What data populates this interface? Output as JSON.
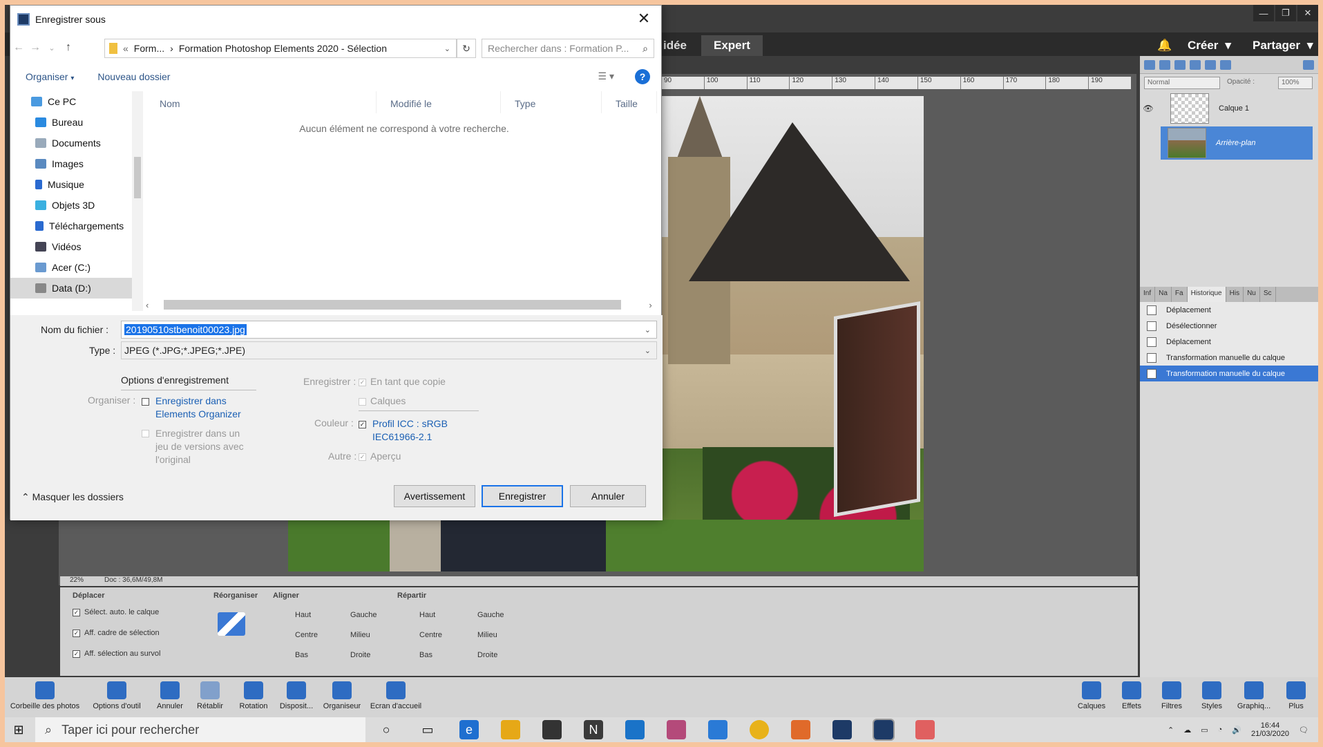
{
  "app": {
    "window_controls": [
      "—",
      "❐",
      "✕"
    ],
    "modes": {
      "guided": "idée",
      "expert": "Expert"
    },
    "create": "Créer",
    "share": "Partager",
    "blend_mode": "Normal",
    "opacity_label": "Opacité :",
    "opacity_value": "100%",
    "layers": [
      {
        "name": "Calque 1"
      },
      {
        "name": "Arrière-plan"
      }
    ],
    "history_tabs": [
      "Inf",
      "Na",
      "Fa",
      "Historique",
      "His",
      "Nu",
      "Sc"
    ],
    "history_items": [
      "Déplacement",
      "Désélectionner",
      "Déplacement",
      "Transformation manuelle du calque",
      "Transformation manuelle du calque"
    ],
    "ruler_ticks": [
      "90",
      "100",
      "110",
      "120",
      "130",
      "140",
      "150",
      "160",
      "170",
      "180",
      "190"
    ],
    "status": {
      "zoom": "22%",
      "doc": "Doc : 36,6M/49,8M"
    },
    "options": {
      "move_title": "Déplacer",
      "move_items": [
        "Sélect. auto. le calque",
        "Aff. cadre de sélection",
        "Aff. sélection au survol"
      ],
      "arrange_title": "Réorganiser",
      "align_title": "Aligner",
      "align_items": [
        "Haut",
        "Centre",
        "Bas",
        "Gauche",
        "Milieu",
        "Droite"
      ],
      "distribute_title": "Répartir",
      "distribute_items": [
        "Haut",
        "Centre",
        "Bas",
        "Gauche",
        "Milieu",
        "Droite"
      ]
    },
    "bottom_left": [
      "Corbeille des photos",
      "Options d'outil",
      "Annuler",
      "Rétablir",
      "Rotation",
      "Disposit...",
      "Organiseur",
      "Ecran d'accueil"
    ],
    "bottom_right": [
      "Calques",
      "Effets",
      "Filtres",
      "Styles",
      "Graphiq...",
      "Plus"
    ]
  },
  "dialog": {
    "title": "Enregistrer sous",
    "path_prefix": "Form...",
    "path_folder": "Formation Photoshop Elements 2020 - Sélection",
    "search_placeholder": "Rechercher dans : Formation P...",
    "organize": "Organiser",
    "new_folder": "Nouveau dossier",
    "nav_items": [
      "Ce PC",
      "Bureau",
      "Documents",
      "Images",
      "Musique",
      "Objets 3D",
      "Téléchargements",
      "Vidéos",
      "Acer (C:)",
      "Data (D:)"
    ],
    "columns": [
      "Nom",
      "Modifié le",
      "Type",
      "Taille"
    ],
    "empty_message": "Aucun élément ne correspond à votre recherche.",
    "filename_label": "Nom du fichier :",
    "filename": "20190510stbenoit00023.jpg",
    "type_label": "Type :",
    "type_value": "JPEG (*.JPG;*.JPEG;*.JPE)",
    "save_options": "Options d'enregistrement",
    "organize_label": "Organiser :",
    "save_in_organizer": "Enregistrer dans Elements Organizer",
    "save_version": "Enregistrer dans un jeu de versions avec l'original",
    "save_label": "Enregistrer :",
    "as_copy": "En tant que copie",
    "layers": "Calques",
    "color_label": "Couleur :",
    "icc_profile": "Profil ICC : sRGB IEC61966-2.1",
    "other_label": "Autre :",
    "preview": "Aperçu",
    "hide_folders": "Masquer les dossiers",
    "btn_warning": "Avertissement",
    "btn_save": "Enregistrer",
    "btn_cancel": "Annuler"
  },
  "taskbar": {
    "search_placeholder": "Taper ici pour rechercher",
    "time": "16:44",
    "date": "21/03/2020"
  }
}
